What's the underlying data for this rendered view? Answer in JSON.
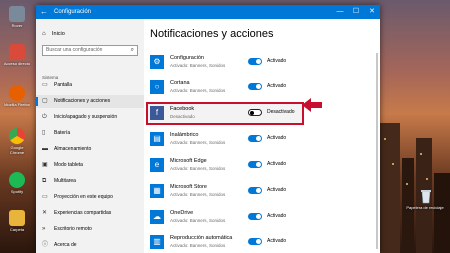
{
  "window": {
    "title": "Configuración"
  },
  "desktop_icons": [
    {
      "label": "Rover",
      "icon": "app-icon",
      "color": "#7a8a9a"
    },
    {
      "label": "Acceso directo",
      "icon": "shortcut-icon",
      "color": "#d94a3a"
    },
    {
      "label": "Mozilla Firefox",
      "icon": "firefox-icon",
      "color": "#e66000"
    },
    {
      "label": "Google Chrome",
      "icon": "chrome-icon",
      "color": "#4285f4"
    },
    {
      "label": "Spotify",
      "icon": "spotify-icon",
      "color": "#1db954"
    },
    {
      "label": "Carpeta",
      "icon": "folder-icon",
      "color": "#e9b43c"
    }
  ],
  "recycle_bin": {
    "label": "Papelera de reciclaje"
  },
  "sidebar": {
    "home": "Inicio",
    "search_placeholder": "Buscar una configuración",
    "section": "Sistema",
    "items": [
      {
        "label": "Pantalla",
        "icon": "display-icon"
      },
      {
        "label": "Notificaciones y acciones",
        "icon": "notifications-icon",
        "active": true
      },
      {
        "label": "Inicio/apagado y suspensión",
        "icon": "power-icon"
      },
      {
        "label": "Batería",
        "icon": "battery-icon"
      },
      {
        "label": "Almacenamiento",
        "icon": "storage-icon"
      },
      {
        "label": "Modo tableta",
        "icon": "tablet-icon"
      },
      {
        "label": "Multitarea",
        "icon": "multitask-icon"
      },
      {
        "label": "Proyección en este equipo",
        "icon": "projection-icon"
      },
      {
        "label": "Experiencias compartidas",
        "icon": "shared-icon"
      },
      {
        "label": "Escritorio remoto",
        "icon": "remote-icon"
      },
      {
        "label": "Acerca de",
        "icon": "info-icon"
      }
    ]
  },
  "main": {
    "heading": "Notificaciones y acciones",
    "apps": [
      {
        "name": "Configuración",
        "sub": "Activado: Banners, Sonidos",
        "state": "Activado",
        "on": true,
        "icon": "gear-icon"
      },
      {
        "name": "Cortana",
        "sub": "Activado: Banners, Sonidos",
        "state": "Activado",
        "on": true,
        "icon": "cortana-icon"
      },
      {
        "name": "Facebook",
        "sub": "Desactivado",
        "state": "Desactivado",
        "on": false,
        "icon": "facebook-icon"
      },
      {
        "name": "Inalámbrico",
        "sub": "Activado: Banners, Sonidos",
        "state": "Activado",
        "on": true,
        "icon": "wireless-icon"
      },
      {
        "name": "Microsoft Edge",
        "sub": "Activado: Banners, Sonidos",
        "state": "Activado",
        "on": true,
        "icon": "edge-icon"
      },
      {
        "name": "Microsoft Store",
        "sub": "Activado: Banners, Sonidos",
        "state": "Activado",
        "on": true,
        "icon": "store-icon"
      },
      {
        "name": "OneDrive",
        "sub": "Activado: Banners, Sonidos",
        "state": "Activado",
        "on": true,
        "icon": "onedrive-icon"
      },
      {
        "name": "Reproducción automática",
        "sub": "Activado: Banners, Sonidos",
        "state": "Activado",
        "on": true,
        "icon": "autoplay-icon"
      }
    ]
  },
  "colors": {
    "accent": "#0078d7",
    "highlight": "#c8102e"
  }
}
